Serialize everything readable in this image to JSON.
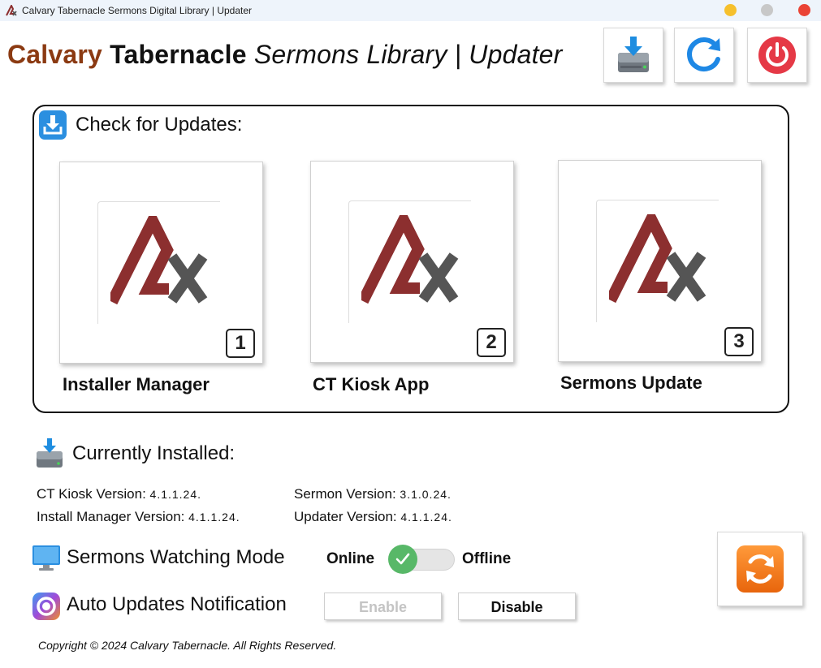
{
  "window": {
    "title": "Calvary Tabernacle Sermons Digital Library | Updater"
  },
  "header": {
    "brand_part1": "Calvary",
    "brand_part2": "Tabernacle",
    "title_rest": "Sermons Library | Updater"
  },
  "toolbar": {
    "buttons": [
      {
        "name": "install",
        "icon": "hard-drive-download-icon"
      },
      {
        "name": "refresh",
        "icon": "refresh-icon"
      },
      {
        "name": "power",
        "icon": "power-icon"
      }
    ]
  },
  "updates": {
    "title": "Check for Updates:",
    "cards": [
      {
        "number": "1",
        "label": "Installer Manager"
      },
      {
        "number": "2",
        "label": "CT Kiosk App"
      },
      {
        "number": "3",
        "label": "Sermons Update"
      }
    ]
  },
  "installed": {
    "title": "Currently Installed:",
    "items": [
      {
        "label": "CT Kiosk Version:",
        "value": "4.1.1.24."
      },
      {
        "label": "Install Manager Version:",
        "value": "4.1.1.24."
      },
      {
        "label": "Sermon Version:",
        "value": "3.1.0.24."
      },
      {
        "label": "Updater Version:",
        "value": "4.1.1.24."
      }
    ]
  },
  "watching_mode": {
    "label": "Sermons Watching Mode",
    "on_label": "Online",
    "off_label": "Offline",
    "state": "Online"
  },
  "auto_updates": {
    "label": "Auto Updates Notification",
    "enable_label": "Enable",
    "disable_label": "Disable",
    "enable_disabled": true
  },
  "footer": {
    "copyright": "Copyright © 2024 Calvary Tabernacle. All Rights Reserved."
  },
  "colors": {
    "brand_brown": "#8b3a12",
    "logo_red": "#8c2f2f",
    "logo_gray": "#555555",
    "toggle_green": "#58b868",
    "sync_orange": "#f07a18"
  }
}
